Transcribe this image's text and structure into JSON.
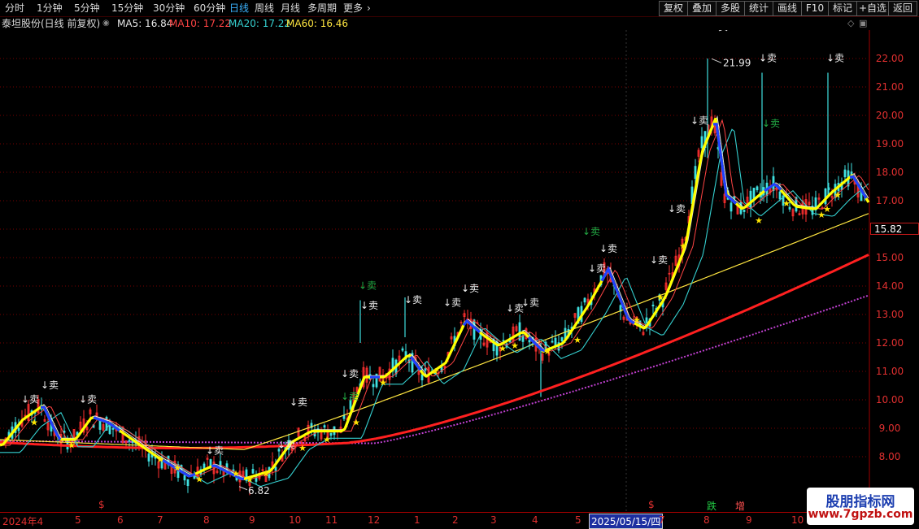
{
  "toolbar": {
    "periods": [
      "分时",
      "1分钟",
      "5分钟",
      "15分钟",
      "30分钟",
      "60分钟",
      "日线",
      "周线",
      "月线",
      "多周期",
      "更多"
    ],
    "active_period": "日线",
    "buttons": [
      "复权",
      "叠加",
      "多股",
      "统计",
      "画线",
      "F10",
      "标记",
      "+自选",
      "返回"
    ]
  },
  "title": {
    "stock": "泰坦股份(日线 前复权)",
    "ma5": "MA5: 16.84",
    "ma10": "MA10: 17.22",
    "ma20": "MA20: 17.22",
    "ma60": "MA60: 16.46"
  },
  "colors": {
    "ma5": "#e8e8e8",
    "ma10": "#ff4444",
    "ma20": "#35d0d0",
    "ma60": "#ffe640",
    "up": "#ff3030",
    "down": "#40e0e0",
    "grid": "#7a0000",
    "axis_text": "#e23030"
  },
  "price_axis": [
    "22.00",
    "21.00",
    "20.00",
    "19.00",
    "18.00",
    "17.00",
    "16.00",
    "15.00",
    "14.00",
    "13.00",
    "12.00",
    "11.00",
    "10.00",
    "9.00",
    "8.00"
  ],
  "current_price": "15.82",
  "high_label": "21.99",
  "low_label": "6.82",
  "dates": [
    "2024年4",
    "5",
    "6",
    "7",
    "8",
    "9",
    "10",
    "11",
    "12",
    "1",
    "2",
    "3",
    "4",
    "5",
    "2025/05/15/四",
    "7",
    "8",
    "9",
    "10"
  ],
  "signal_labels": {
    "sell": "↓卖",
    "buy": "★",
    "event_down": "跌",
    "event_add": "增",
    "marker": "$"
  },
  "watermark": {
    "line1": "股朋指标网",
    "line2": "www.7gpzb.com"
  }
}
